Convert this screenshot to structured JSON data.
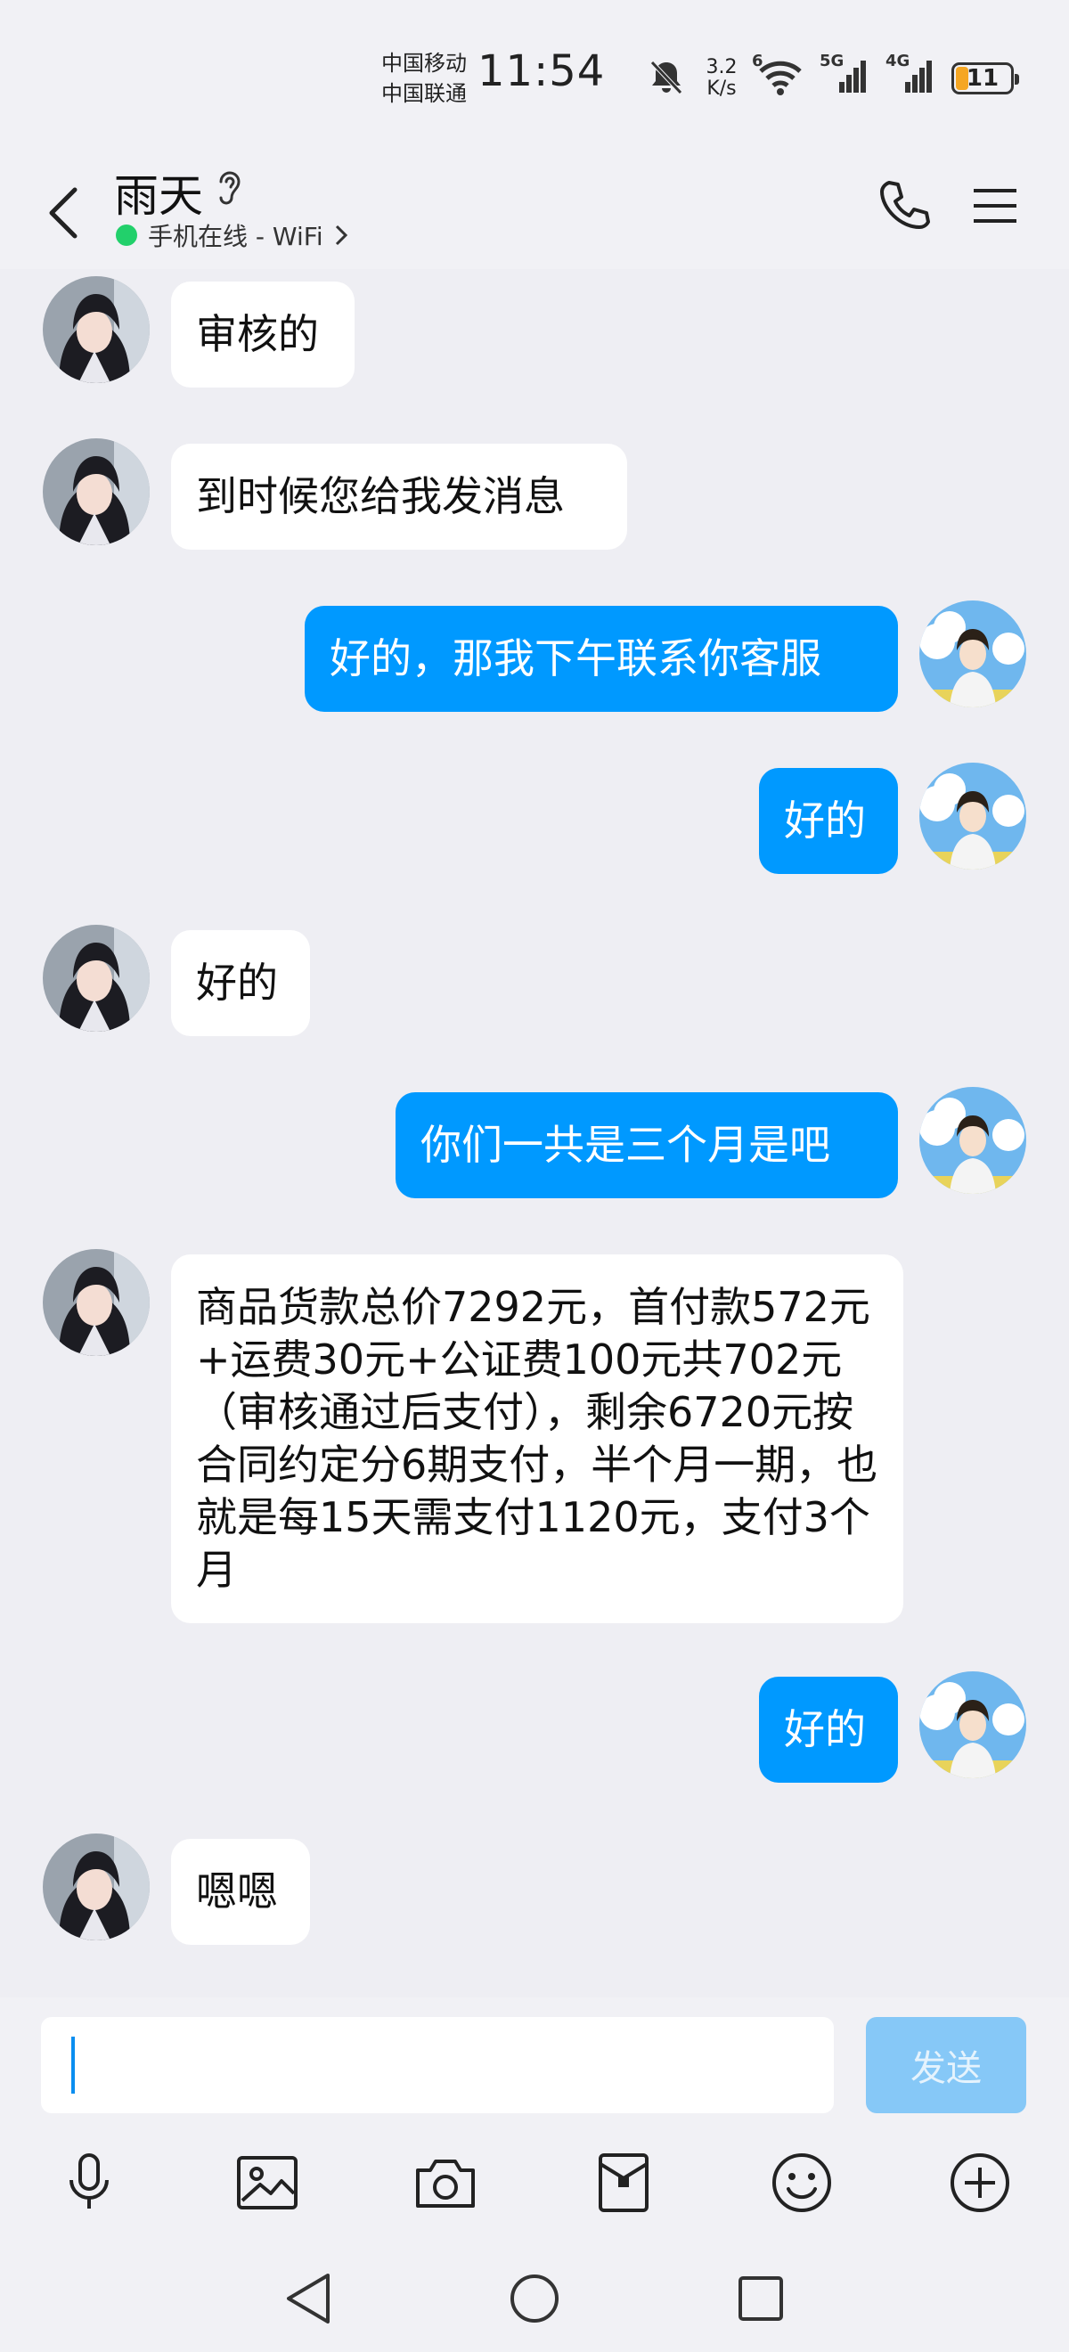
{
  "status_bar": {
    "carrier1": "中国移动",
    "carrier2": "中国联通",
    "time": "11:54",
    "net_speed_value": "3.2",
    "net_speed_unit": "K/s",
    "wifi_label": "6",
    "sim1_label": "5G",
    "sim2_label": "4G",
    "battery": "11"
  },
  "header": {
    "contact_name": "雨天",
    "online_status": "手机在线 - WiFi",
    "online_color": "#22d06b"
  },
  "messages": [
    {
      "side": "in",
      "text": "审核的"
    },
    {
      "side": "in",
      "text": "到时候您给我发消息"
    },
    {
      "side": "out",
      "text": "好的，那我下午联系你客服"
    },
    {
      "side": "out",
      "text": "好的"
    },
    {
      "side": "in",
      "text": "好的"
    },
    {
      "side": "out",
      "text": "你们一共是三个月是吧"
    },
    {
      "side": "in",
      "text": "商品货款总价7292元，首付款572元+运费30元+公证费100元共702元（审核通过后支付），剩余6720元按合同约定分6期支付，半个月一期，也就是每15天需支付1120元，支付3个月"
    },
    {
      "side": "out",
      "text": "好的"
    },
    {
      "side": "in",
      "text": "嗯嗯"
    }
  ],
  "composer": {
    "input_value": "",
    "send_label": "发送"
  },
  "toolbar": {
    "icons": [
      "microphone-icon",
      "image-icon",
      "camera-icon",
      "red-packet-icon",
      "emoji-icon",
      "plus-icon"
    ]
  },
  "colors": {
    "accent": "#0099ff",
    "background": "#eeeef3",
    "send_disabled": "#86c8f7"
  }
}
